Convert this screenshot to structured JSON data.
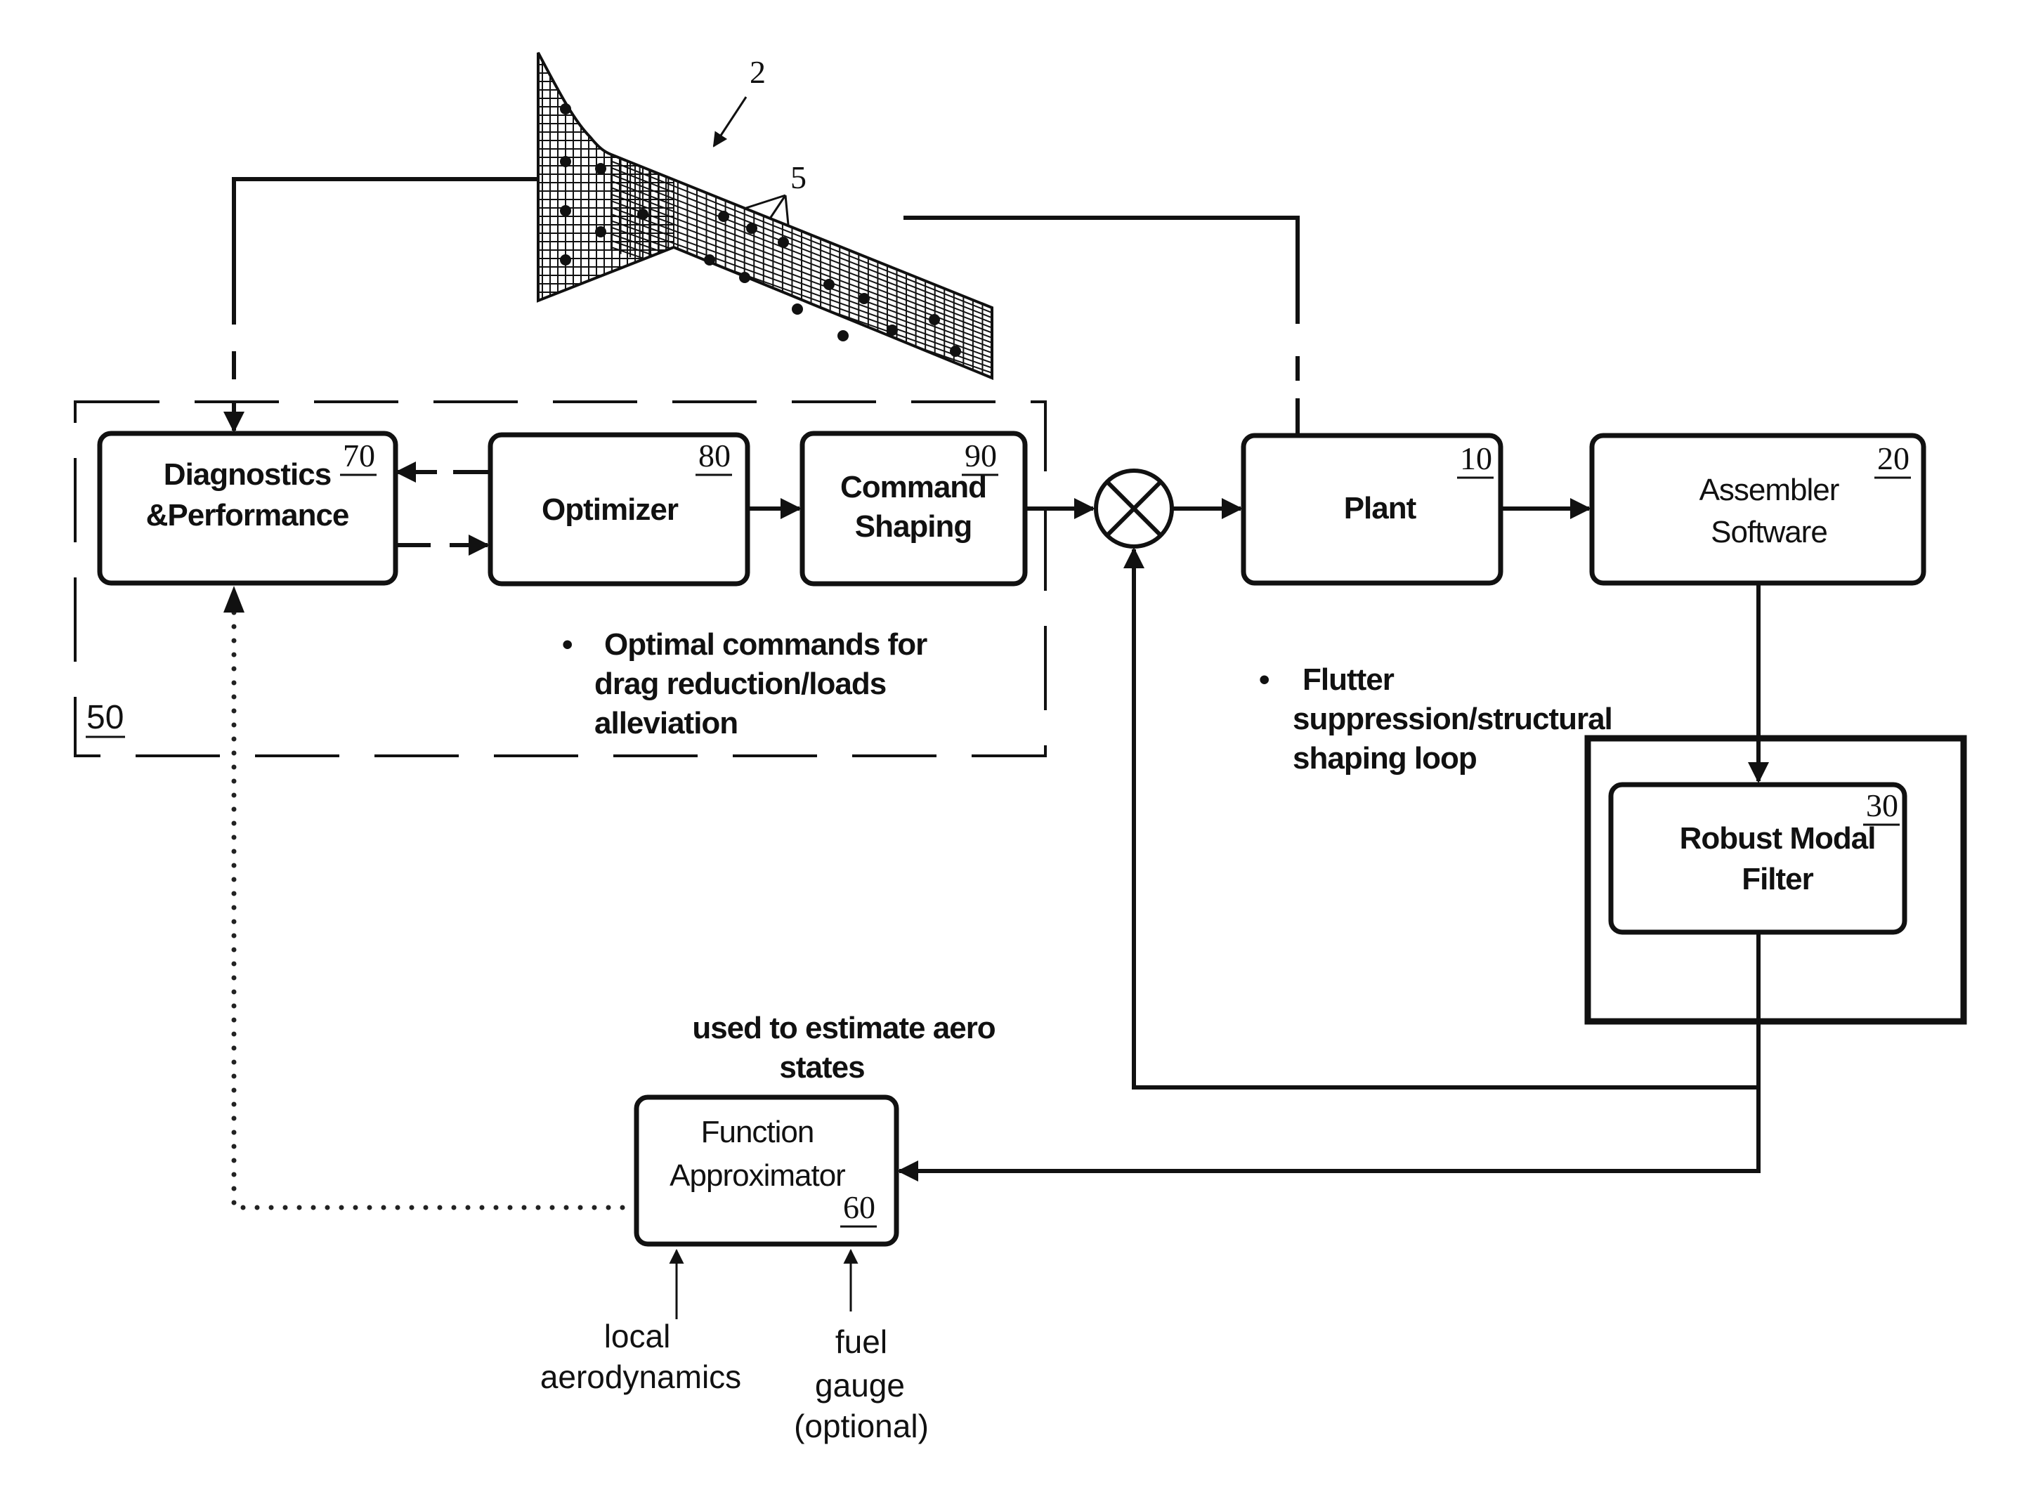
{
  "figure": {
    "wing_model": {
      "ref": "2",
      "sensor_ref": "5",
      "description": "wing finite-element mesh with sensors"
    },
    "group": {
      "ref": "50"
    },
    "blocks": [
      {
        "id": "diagnostics",
        "lines": [
          "Diagnostics",
          "&Performance"
        ],
        "ref": "70",
        "weight": "bold"
      },
      {
        "id": "optimizer",
        "lines": [
          "Optimizer"
        ],
        "ref": "80",
        "weight": "bold"
      },
      {
        "id": "command-shaping",
        "lines": [
          "Command",
          "Shaping"
        ],
        "ref": "90",
        "weight": "bold"
      },
      {
        "id": "plant",
        "lines": [
          "Plant"
        ],
        "ref": "10",
        "weight": "bold"
      },
      {
        "id": "assembler",
        "lines": [
          "Assembler",
          "Software"
        ],
        "ref": "20",
        "weight": "regular"
      },
      {
        "id": "robust-modal-filter",
        "lines": [
          "Robust Modal",
          "Filter"
        ],
        "ref": "30",
        "weight": "bold"
      },
      {
        "id": "function-approximator",
        "lines": [
          "Function",
          "Approximator"
        ],
        "ref": "60",
        "weight": "regular"
      }
    ],
    "notes": {
      "optimal": {
        "bullet": "•",
        "lines": [
          "Optimal commands for",
          "drag reduction/loads",
          "alleviation"
        ]
      },
      "flutter": {
        "bullet": "•",
        "lines": [
          "Flutter",
          "suppression/structural",
          "shaping loop"
        ]
      },
      "aero": {
        "lines": [
          "used to estimate aero",
          "states"
        ]
      }
    },
    "inputs": {
      "local": {
        "lines": [
          "local",
          "aerodynamics"
        ]
      },
      "fuel": {
        "lines": [
          "fuel",
          "gauge",
          "(optional)"
        ]
      }
    },
    "summing_junction": {
      "symbol": "multiply-circle"
    }
  }
}
